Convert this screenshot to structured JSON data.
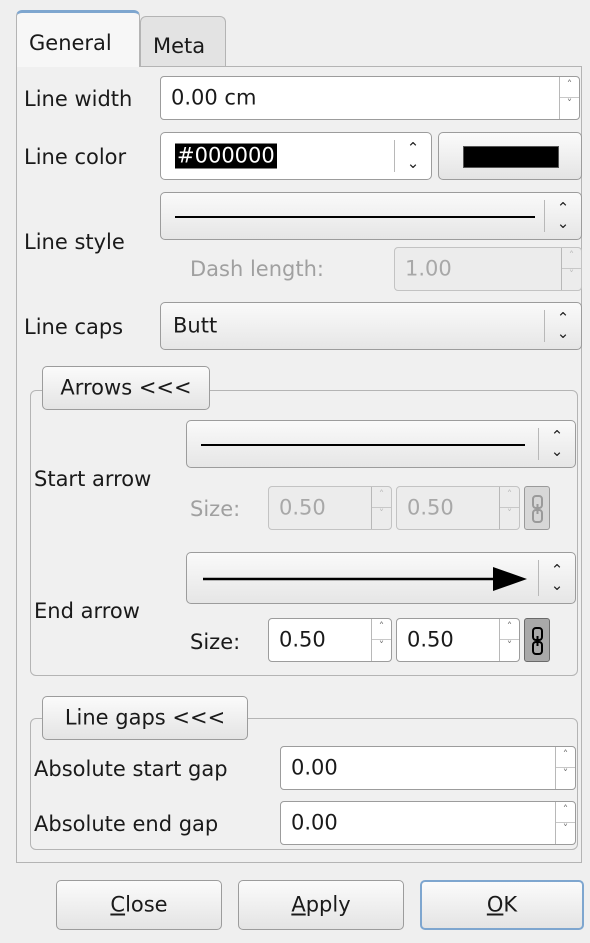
{
  "tabs": [
    {
      "label": "General",
      "active": true
    },
    {
      "label": "Meta",
      "active": false
    }
  ],
  "general": {
    "line_width": {
      "label": "Line width",
      "value": "0.00 cm"
    },
    "line_color": {
      "label": "Line color",
      "value": "#000000",
      "swatch_color": "#000000"
    },
    "line_style": {
      "label": "Line style",
      "dash_length_label": "Dash length:",
      "dash_length_value": "1.00"
    },
    "line_caps": {
      "label": "Line caps",
      "value": "Butt"
    },
    "arrows": {
      "toggle_label": "Arrows <<<",
      "start": {
        "label": "Start arrow",
        "size_label": "Size:",
        "width": "0.50",
        "height": "0.50",
        "enabled": false
      },
      "end": {
        "label": "End arrow",
        "size_label": "Size:",
        "width": "0.50",
        "height": "0.50",
        "enabled": true
      }
    },
    "line_gaps": {
      "toggle_label": "Line gaps <<<",
      "start_gap": {
        "label": "Absolute start gap",
        "value": "0.00"
      },
      "end_gap": {
        "label": "Absolute end gap",
        "value": "0.00"
      }
    }
  },
  "buttons": {
    "close": {
      "mnemonic": "C",
      "rest": "lose"
    },
    "apply": {
      "mnemonic": "A",
      "rest": "pply"
    },
    "ok": {
      "mnemonic": "O",
      "rest": "K"
    }
  },
  "colors": {
    "tab_accent": "#7ea6cf",
    "selection_bg": "#000000",
    "selection_fg": "#ffffff"
  }
}
